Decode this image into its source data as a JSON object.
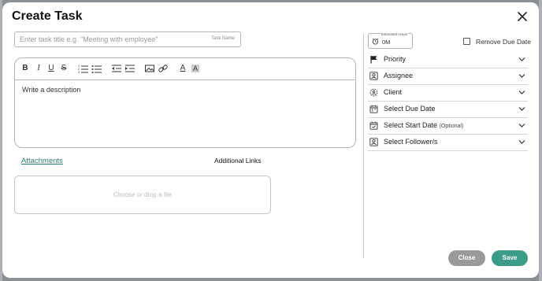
{
  "modal": {
    "title": "Create Task"
  },
  "task": {
    "placeholder": "Enter task title e.g. \"Meeting with employee\"",
    "tag": "Task Name"
  },
  "editor": {
    "toolbar": [
      "bold-icon",
      "italic-icon",
      "underline-icon",
      "strikethrough-icon",
      "ordered-list-icon",
      "bullet-list-icon",
      "outdent-icon",
      "indent-icon",
      "image-icon",
      "link-icon",
      "font-color-icon",
      "highlight-icon"
    ],
    "placeholder": "Write a description"
  },
  "attachments": {
    "link_label": "Attachments",
    "additional_links_label": "Additional Links",
    "dropzone_text": "Choose or drop a file"
  },
  "estimate": {
    "label": "Estimated Hours",
    "value": "0M"
  },
  "due": {
    "remove_label": "Remove Due Date",
    "checked": false
  },
  "fields": [
    {
      "label": "Priority",
      "icon": "flag-icon"
    },
    {
      "label": "Assignee",
      "icon": "user-card-icon"
    },
    {
      "label": "Client",
      "icon": "client-gear-icon"
    },
    {
      "label": "Select Due Date",
      "icon": "calendar-icon"
    },
    {
      "label": "Select Start Date",
      "optional": "(Optional)",
      "icon": "calendar-check-icon"
    },
    {
      "label": "Select Follower/s",
      "icon": "user-card-icon"
    }
  ],
  "buttons": {
    "close": "Close",
    "save": "Save"
  },
  "colors": {
    "accent": "#3d9b8a",
    "link": "#2a7d73",
    "close_button": "#9a9a9a"
  }
}
